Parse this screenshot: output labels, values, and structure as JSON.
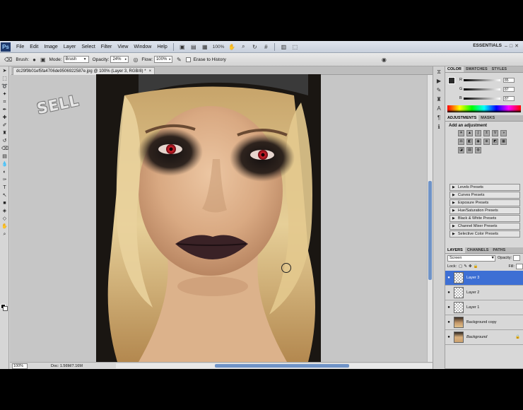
{
  "appbar": {
    "logo": "Ps",
    "menus": [
      "File",
      "Edit",
      "Image",
      "Layer",
      "Select",
      "Filter",
      "View",
      "Window",
      "Help"
    ],
    "zoom": "100%",
    "workspace": "ESSENTIALS"
  },
  "options": {
    "tool_label": "Brush:",
    "mode_label": "Mode:",
    "mode_value": "Brush",
    "opacity_label": "Opacity:",
    "opacity_value": "24%",
    "flow_label": "Flow:",
    "flow_value": "100%",
    "erase_history_label": "Erase to History"
  },
  "document": {
    "tab_title": "dc29f9b01ef5fa4706de9506922587e.jpg @ 100% (Layer 3, RGB/8) *",
    "watermark": "SELL"
  },
  "status": {
    "zoom": "100%",
    "doc_info": "Doc: 1.56M/7.16M"
  },
  "color_panel": {
    "tabs": [
      "COLOR",
      "SWATCHES",
      "STYLES"
    ],
    "channels": [
      {
        "name": "R",
        "value": "85"
      },
      {
        "name": "G",
        "value": "87"
      },
      {
        "name": "B",
        "value": "87"
      }
    ]
  },
  "adjustments_panel": {
    "tabs": [
      "ADJUSTMENTS",
      "MASKS"
    ],
    "title": "Add an adjustment",
    "presets": [
      "Levels Presets",
      "Curves Presets",
      "Exposure Presets",
      "Hue/Saturation Presets",
      "Black & White Presets",
      "Channel Mixer Presets",
      "Selective Color Presets"
    ]
  },
  "layers_panel": {
    "tabs": [
      "LAYERS",
      "CHANNELS",
      "PATHS"
    ],
    "blend_mode": "Screen",
    "opacity_label": "Opacity:",
    "lock_label": "Lock:",
    "fill_label": "Fill:",
    "layers": [
      {
        "name": "Layer 3",
        "selected": true
      },
      {
        "name": "Layer 2",
        "selected": false
      },
      {
        "name": "Layer 1",
        "selected": false
      },
      {
        "name": "Background copy",
        "selected": false
      },
      {
        "name": "Background",
        "selected": false
      }
    ]
  },
  "colors": {
    "selected_layer": "#3d6fd4",
    "scroll_thumb": "#6f93c7",
    "eye_color": "#d0202a"
  }
}
